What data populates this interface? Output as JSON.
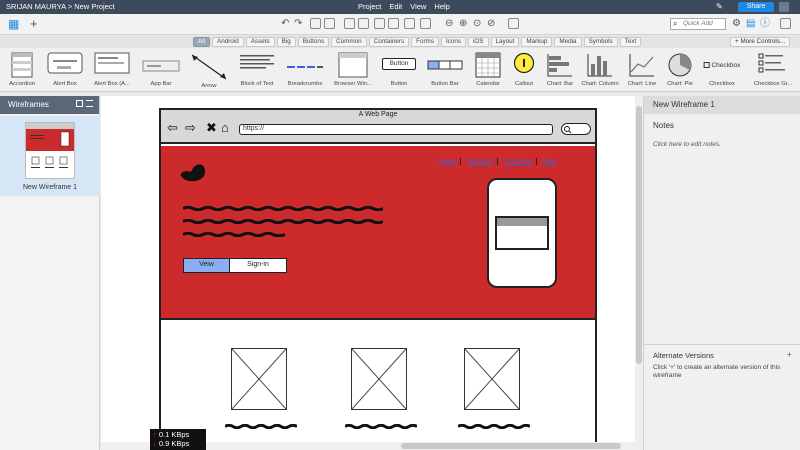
{
  "topbar": {
    "breadcrumb": "SRIJAN MAURYA > New Project",
    "menu": [
      "Project",
      "Edit",
      "View",
      "Help"
    ],
    "share_label": "Share"
  },
  "toolbar": {
    "quick_add_placeholder": "Quick Add"
  },
  "filters": {
    "items": [
      "All",
      "Android",
      "Assets",
      "Big",
      "Buttons",
      "Common",
      "Containers",
      "Forms",
      "Icons",
      "iOS",
      "Layout",
      "Markup",
      "Media",
      "Symbols",
      "Text"
    ],
    "active": "All",
    "more_controls": "More Controls..."
  },
  "library": {
    "items": [
      "Accordion",
      "Alert Box",
      "Alert Box (A...",
      "App Bar",
      "Arrow",
      "Block of Text",
      "Breadcrumbs",
      "Browser Win...",
      "Button",
      "Button Bar",
      "Calendar",
      "Callout",
      "Chart: Bar",
      "Chart: Column",
      "Chart: Line",
      "Chart: Pie",
      "Checkbox",
      "Checkbox Gr..."
    ],
    "button_thumb_text": "Button",
    "checkbox_thumb_text": "Checkbox"
  },
  "left_panel": {
    "title": "Wireframes",
    "wireframe_name": "New Wireframe 1"
  },
  "mockup": {
    "page_title": "A Web Page",
    "url": "https://",
    "nav_links": [
      "Home",
      "Products",
      "Company",
      "Blog"
    ],
    "view_button": "Veiw",
    "signin_button": "Sign-in"
  },
  "right_panel": {
    "wireframe_name": "New Wireframe 1",
    "notes_label": "Notes",
    "notes_hint": "Click here to edit notes.",
    "alt_versions_label": "Alternate Versions",
    "alt_versions_plus": "+",
    "alt_versions_hint": "Click '+' to create an alternate version of this wireframe"
  },
  "netmon": {
    "upload": "0.1 KBps",
    "download": "0.9 KBps"
  },
  "colors": {
    "topbar": "#3c4a5c",
    "hero": "#cd2b2b",
    "selected": "#d5e7f7",
    "share": "#1e88e5"
  }
}
